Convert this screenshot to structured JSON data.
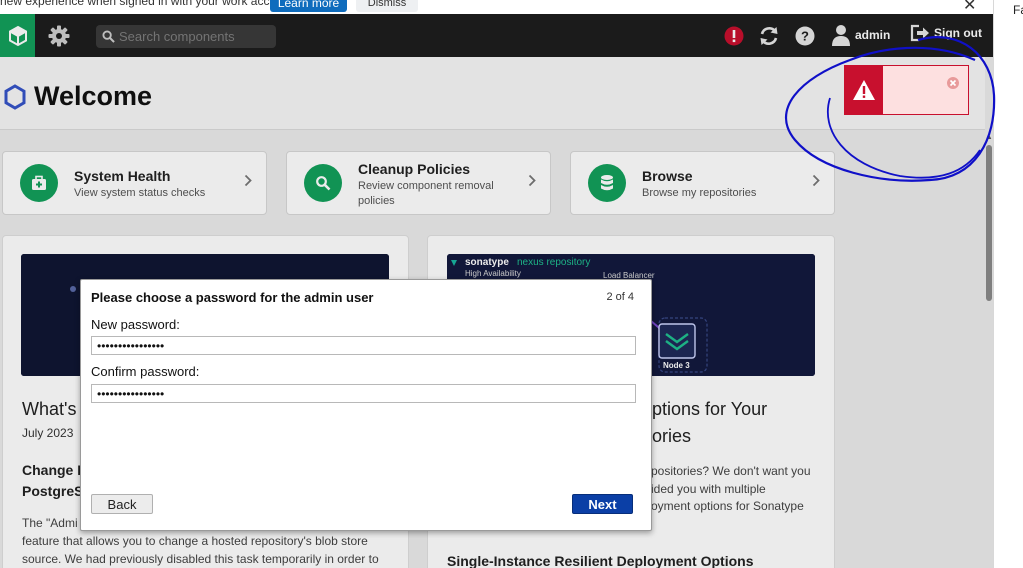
{
  "browser_bar": {
    "message": "new experience when signed in with your work account.",
    "learn_more": "Learn more",
    "dismiss": "Dismiss",
    "close_glyph": "✕",
    "right_text": "Fa"
  },
  "header": {
    "search_placeholder": "Search components",
    "user_label": "admin",
    "signout_label": "Sign out",
    "icons": [
      "cube-logo-icon",
      "gear-icon",
      "search-icon",
      "alert-icon",
      "refresh-icon",
      "help-icon",
      "user-icon",
      "signout-icon"
    ]
  },
  "page": {
    "title": "Welcome",
    "cards": [
      {
        "title": "System Health",
        "subtitle": "View system status checks",
        "icon": "health-kit-icon"
      },
      {
        "title": "Cleanup Policies",
        "subtitle_line1": "Review component removal",
        "subtitle_line2": "policies",
        "icon": "magnifier-icon"
      },
      {
        "title": "Browse",
        "subtitle": "Browse my repositories",
        "icon": "database-icon"
      }
    ],
    "left_panel": {
      "heading_fragment": "What's",
      "date": "July 2023",
      "sub_line1": "Change F",
      "sub_line2": "PostgreS",
      "body_line1": "The \"Admi",
      "body_line2": "feature that allows you to change a hosted repository's blob store",
      "body_line3": "source. We had previously disabled this task temporarily in order to"
    },
    "right_panel": {
      "banner_brand": "sonatype",
      "banner_product": "nexus repository",
      "banner_line1": "High Availability",
      "banner_line2": "Load Balancer",
      "banner_node": "Node 3",
      "heading_line1": "ptions for Your",
      "heading_line2": "ories",
      "body_line1": "positories? We don't want you",
      "body_line2": "ided you with multiple",
      "body_line3": "oyment options for Sonatype",
      "bottom_heading": "Single-Instance Resilient Deployment Options"
    }
  },
  "toast": {
    "type": "error",
    "color": "#c8102e"
  },
  "modal": {
    "title": "Please choose a password for the admin user",
    "step": "2 of 4",
    "new_password_label": "New password:",
    "new_password_value": "••••••••••••••••",
    "confirm_password_label": "Confirm password:",
    "confirm_password_value": "••••••••••••••••",
    "back_label": "Back",
    "next_label": "Next"
  },
  "colors": {
    "brand_green": "#13a05c",
    "header_bg": "#1e1e1e",
    "primary_blue": "#0b3fa6",
    "error_red": "#c8102e",
    "annotation_blue": "#1010c8"
  }
}
